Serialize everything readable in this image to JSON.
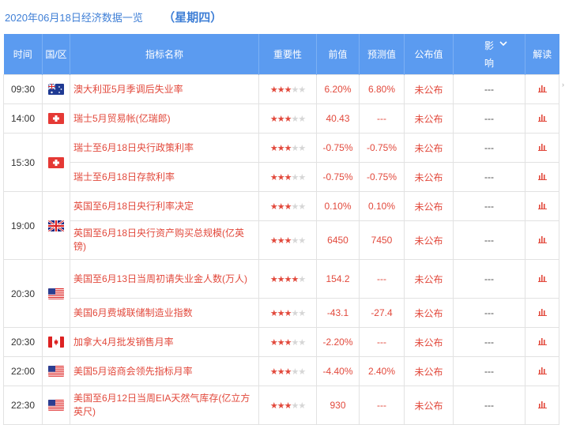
{
  "header": {
    "date_title": "2020年06月18日经济数据一览",
    "weekday": "（星期四）"
  },
  "columns": {
    "time": "时间",
    "region": "国/区",
    "indicator": "指标名称",
    "importance": "重要性",
    "previous": "前值",
    "forecast": "预测值",
    "actual": "公布值",
    "impact": "影响",
    "analysis": "解读"
  },
  "rows": [
    {
      "time": "09:30",
      "flag": "australia",
      "name": "澳大利亚5月季调后失业率",
      "stars": 3,
      "previous": "6.20%",
      "forecast": "6.80%",
      "actual": "未公布",
      "impact": "---"
    },
    {
      "time": "14:00",
      "flag": "switzerland",
      "name": "瑞士5月贸易帐(亿瑞郎)",
      "stars": 3,
      "previous": "40.43",
      "forecast": "---",
      "actual": "未公布",
      "impact": "---"
    },
    {
      "time": "15:30",
      "flag": "switzerland",
      "name": "瑞士至6月18日央行政策利率",
      "stars": 3,
      "previous": "-0.75%",
      "forecast": "-0.75%",
      "actual": "未公布",
      "impact": "---"
    },
    {
      "time": "",
      "flag": "",
      "name": "瑞士至6月18日存款利率",
      "stars": 3,
      "previous": "-0.75%",
      "forecast": "-0.75%",
      "actual": "未公布",
      "impact": "---"
    },
    {
      "time": "19:00",
      "flag": "uk",
      "name": "英国至6月18日央行利率决定",
      "stars": 3,
      "previous": "0.10%",
      "forecast": "0.10%",
      "actual": "未公布",
      "impact": "---"
    },
    {
      "time": "",
      "flag": "",
      "name": "英国至6月18日央行资产购买总规模(亿英镑)",
      "stars": 3,
      "previous": "6450",
      "forecast": "7450",
      "actual": "未公布",
      "impact": "---"
    },
    {
      "time": "20:30",
      "flag": "usa",
      "name": "美国至6月13日当周初请失业金人数(万人)",
      "stars": 4,
      "previous": "154.2",
      "forecast": "---",
      "actual": "未公布",
      "impact": "---"
    },
    {
      "time": "",
      "flag": "",
      "name": "美国6月费城联储制造业指数",
      "stars": 3,
      "previous": "-43.1",
      "forecast": "-27.4",
      "actual": "未公布",
      "impact": "---"
    },
    {
      "time": "20:30",
      "flag": "canada",
      "name": "加拿大4月批发销售月率",
      "stars": 3,
      "previous": "-2.20%",
      "forecast": "---",
      "actual": "未公布",
      "impact": "---"
    },
    {
      "time": "22:00",
      "flag": "usa",
      "name": "美国5月谘商会领先指标月率",
      "stars": 3,
      "previous": "-4.40%",
      "forecast": "2.40%",
      "actual": "未公布",
      "impact": "---"
    },
    {
      "time": "22:30",
      "flag": "usa",
      "name": "美国至6月12日当周EIA天然气库存(亿立方英尺)",
      "stars": 3,
      "previous": "930",
      "forecast": "---",
      "actual": "未公布",
      "impact": "---"
    }
  ],
  "colors": {
    "header_bg": "#5b9bf0",
    "accent_red": "#e2493c",
    "title_blue": "#3f7fd6"
  }
}
